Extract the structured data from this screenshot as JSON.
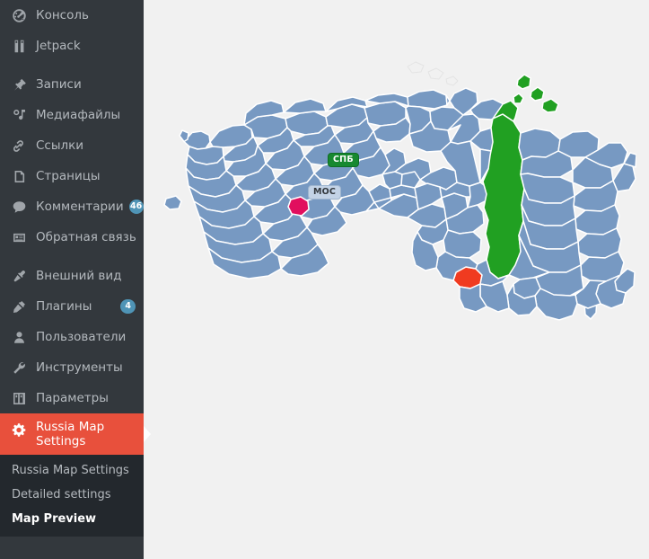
{
  "app": {
    "title": "Russia Map Settings",
    "page": "Map Preview"
  },
  "colors": {
    "sidebar_bg": "#33383d",
    "submenu_bg": "#23282d",
    "active_item_bg": "#e8503c",
    "badge_bg": "#4f94b6",
    "content_bg": "#f1f1f1",
    "region_default": "#7799c2",
    "region_border": "#ffffff",
    "region_selected_green": "#21a022",
    "region_selected_red": "#f03b20",
    "region_selected_pink": "#e10f5e",
    "label_spb_bg": "#17892f",
    "label_mos_bg": "#c3d3e6"
  },
  "sidebar": {
    "items": [
      {
        "id": "dashboard",
        "label": "Консоль",
        "icon": "dashboard-icon",
        "badge": null,
        "gap_after": false
      },
      {
        "id": "jetpack",
        "label": "Jetpack",
        "icon": "jetpack-icon",
        "badge": null,
        "gap_after": true
      },
      {
        "id": "posts",
        "label": "Записи",
        "icon": "pin-icon",
        "badge": null,
        "gap_after": false
      },
      {
        "id": "media",
        "label": "Медиафайлы",
        "icon": "media-icon",
        "badge": null,
        "gap_after": false
      },
      {
        "id": "links",
        "label": "Ссылки",
        "icon": "link-icon",
        "badge": null,
        "gap_after": false
      },
      {
        "id": "pages",
        "label": "Страницы",
        "icon": "page-icon",
        "badge": null,
        "gap_after": false
      },
      {
        "id": "comments",
        "label": "Комментарии",
        "icon": "comment-icon",
        "badge": "46",
        "gap_after": false
      },
      {
        "id": "feedback",
        "label": "Обратная связь",
        "icon": "feedback-icon",
        "badge": null,
        "gap_after": true
      },
      {
        "id": "appearance",
        "label": "Внешний вид",
        "icon": "brush-icon",
        "badge": null,
        "gap_after": false
      },
      {
        "id": "plugins",
        "label": "Плагины",
        "icon": "plugin-icon",
        "badge": "4",
        "gap_after": false
      },
      {
        "id": "users",
        "label": "Пользователи",
        "icon": "user-icon",
        "badge": null,
        "gap_after": false
      },
      {
        "id": "tools",
        "label": "Инструменты",
        "icon": "wrench-icon",
        "badge": null,
        "gap_after": false
      },
      {
        "id": "settings",
        "label": "Параметры",
        "icon": "sliders-icon",
        "badge": null,
        "gap_after": false
      }
    ],
    "current_item": {
      "id": "russia-map-settings",
      "label": "Russia Map Settings",
      "icon": "gear-icon"
    },
    "submenu": [
      {
        "id": "russia-map-settings",
        "label": "Russia Map Settings",
        "current": false
      },
      {
        "id": "detailed-settings",
        "label": "Detailed settings",
        "current": false
      },
      {
        "id": "map-preview",
        "label": "Map Preview",
        "current": true
      }
    ]
  },
  "map": {
    "name": "russia-regions-map",
    "labels": [
      {
        "id": "spb",
        "text": "СПБ",
        "style": "green"
      },
      {
        "id": "mos",
        "text": "МОС",
        "style": "light"
      }
    ],
    "highlighted_regions": [
      {
        "id": "krasnoyarsk-krai",
        "color": "#21a022"
      },
      {
        "id": "tyva-republic",
        "color": "#f03b20"
      },
      {
        "id": "tatarstan",
        "color": "#e10f5e"
      }
    ]
  }
}
